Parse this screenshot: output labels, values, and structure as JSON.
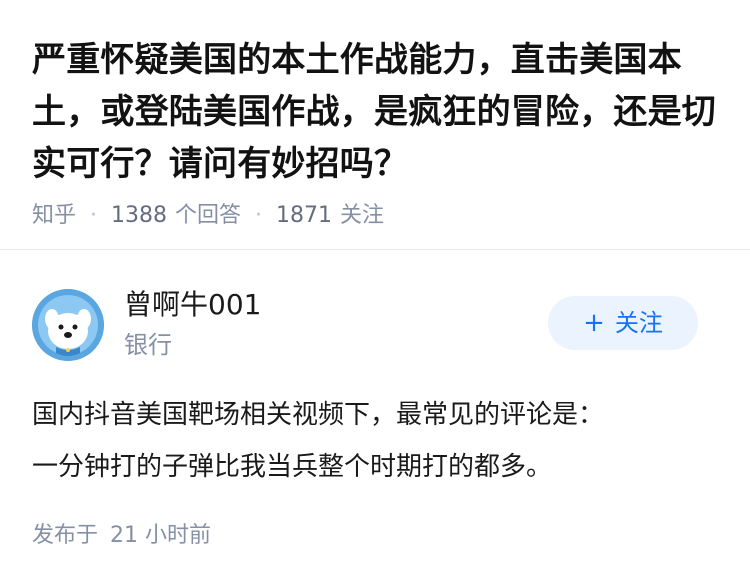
{
  "question": {
    "title": "严重怀疑美国的本土作战能力，直击美国本土，或登陆美国作战，是疯狂的冒险，还是切实可行？请问有妙招吗？",
    "meta": {
      "source": "知乎",
      "answer_count": "1388",
      "answer_label": "个回答",
      "follower_count": "1871",
      "follower_label": "关注"
    }
  },
  "answer": {
    "author": {
      "name": "曾啊牛001",
      "headline": "银行",
      "avatar_icon": "cartoon-dog-avatar"
    },
    "follow_button": {
      "icon": "plus-icon",
      "plus": "+",
      "label": "关注"
    },
    "paragraphs": [
      "国内抖音美国靶场相关视频下，最常见的评论是：",
      "一分钟打的子弹比我当兵整个时期打的都多。"
    ],
    "time": {
      "prefix": "发布于",
      "value": "21 小时前"
    }
  },
  "colors": {
    "accent": "#1772f6",
    "follow_bg": "#eaf3fe",
    "meta_text": "#8590a6",
    "title_text": "#121212"
  }
}
